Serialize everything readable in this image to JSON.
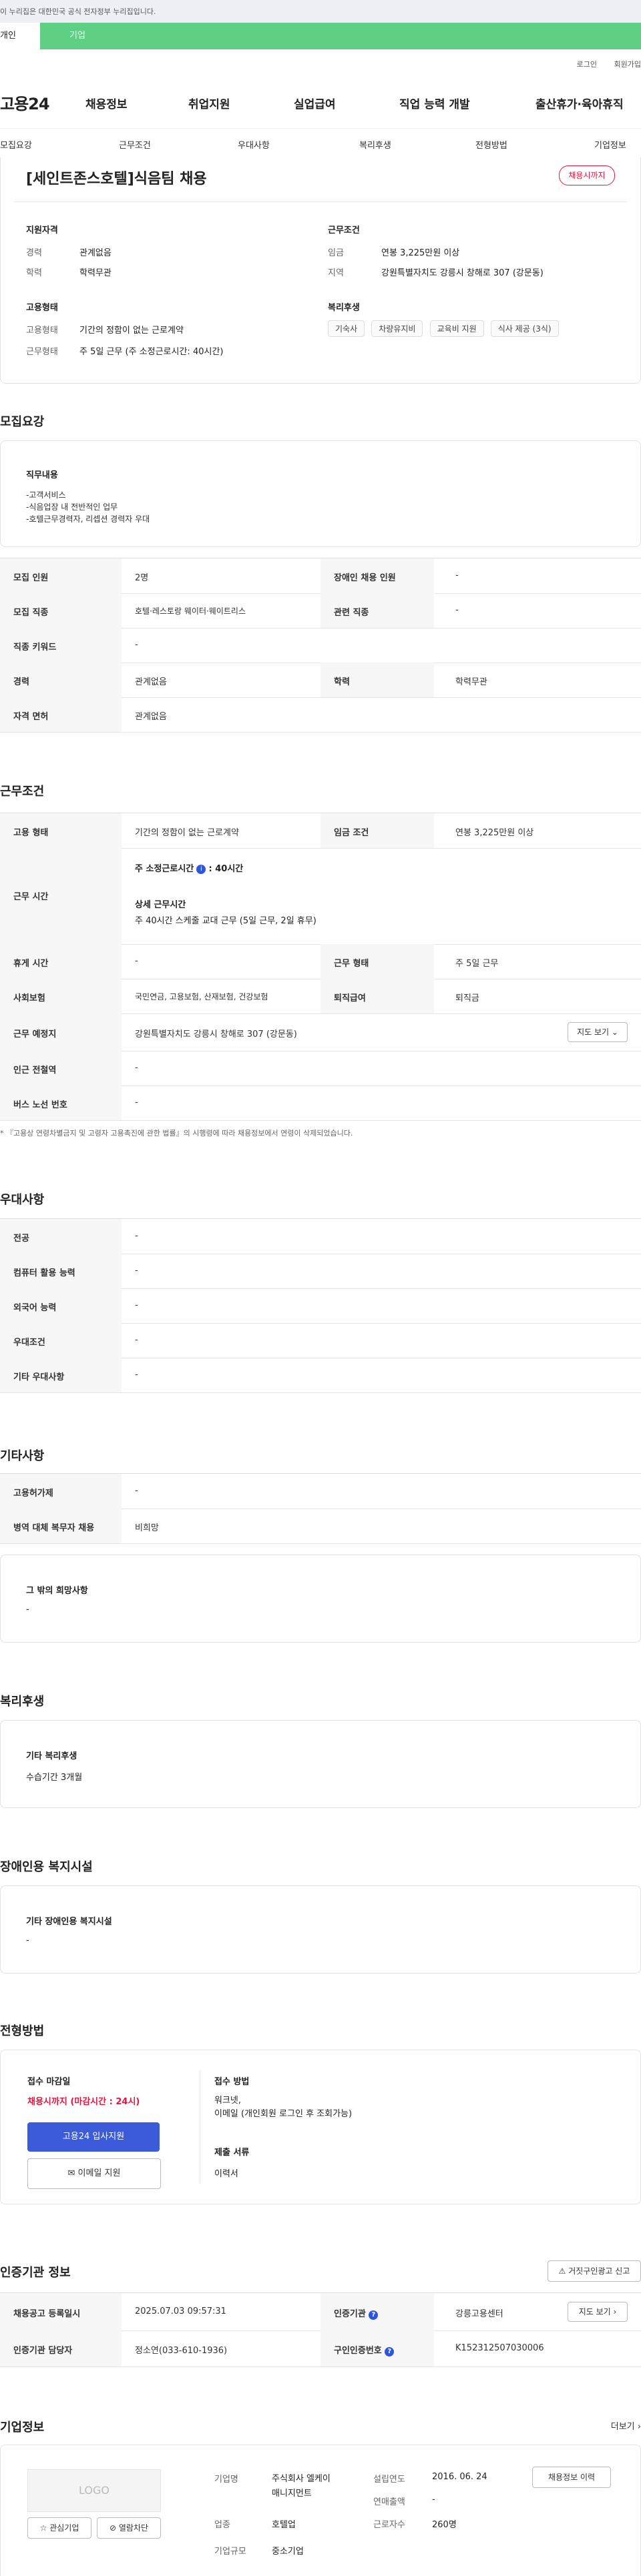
{
  "notice": {
    "text": "이 누리집은 대한민국 공식 전자정부 누리집입니다."
  },
  "topbar": {
    "tab_personal": "개인",
    "tab_company": "기업"
  },
  "util": {
    "login": "로그인",
    "join": "회원가입"
  },
  "gnb": {
    "logo": "고용24",
    "menus": [
      "채용정보",
      "취업지원",
      "실업급여",
      "직업 능력 개발",
      "출산휴가·육아휴직"
    ]
  },
  "subnav": [
    "모집요강",
    "근무조건",
    "우대사항",
    "복리후생",
    "전형방법",
    "기업정보"
  ],
  "summary": {
    "title": "[세인트존스호텔]식음팀 채용",
    "status_badge": "채용시까지",
    "qual_title": "지원자격",
    "career_label": "경력",
    "career_value": "관계없음",
    "edu_label": "학력",
    "edu_value": "학력무관",
    "work_title": "근무조건",
    "wage_label": "임금",
    "wage_value": "연봉 3,225만원 이상",
    "region_label": "지역",
    "region_value": "강원특별자치도 강릉시 창해로 307 (강문동)",
    "emp_title": "고용형태",
    "emp_type_label": "고용형태",
    "emp_type_value": "기간의 정함이 없는 근로계약",
    "work_type_label": "근무형태",
    "work_type_value": "주 5일 근무 (주 소정근로시간: 40시간)",
    "welfare_title": "복리후생",
    "welfare_chips": [
      "기숙사",
      "차량유지비",
      "교육비 지원",
      "식사 제공 (3식)"
    ]
  },
  "recruit": {
    "section_title": "모집요강",
    "duty_title": "직무내용",
    "duty_lines": [
      "-고객서비스",
      "-식음업장 내 전반적인 업무",
      "-호텔근무경력자, 리셉션 경력자 우대"
    ],
    "rows": {
      "headcount_k": "모집 인원",
      "headcount_v": "2명",
      "disabled_k": "장애인 채용 인원",
      "disabled_v": "-",
      "job_k": "모집 직종",
      "job_v": "호텔·레스토랑 웨이터·웨이트리스",
      "related_k": "관련 직종",
      "related_v": "-",
      "keyword_k": "직종 키워드",
      "keyword_v": "-",
      "career_k": "경력",
      "career_v": "관계없음",
      "edu_k": "학력",
      "edu_v": "학력무관",
      "license_k": "자격 면허",
      "license_v": "관계없음"
    }
  },
  "conditions": {
    "section_title": "근무조건",
    "emp_k": "고용 형태",
    "emp_v": "기간의 정함이 없는 근로계약",
    "wage_k": "임금 조건",
    "wage_v": "연봉 3,225만원 이상",
    "hours_k": "근무 시간",
    "hours_weekly_label": "주 소정근로시간",
    "hours_weekly_value": ": 40시간",
    "hours_detail_label": "상세 근무시간",
    "hours_detail_value": "주 40시간 스케줄 교대 근무 (5일 근무, 2일 휴무)",
    "rest_k": "휴게 시간",
    "rest_v": "-",
    "form_k": "근무 형태",
    "form_v": "주 5일 근무",
    "insurance_k": "사회보험",
    "insurance_v": "국민연금, 고용보험, 산재보험, 건강보험",
    "retire_k": "퇴직급여",
    "retire_v": "퇴직금",
    "place_k": "근무 예정지",
    "place_v": "강원특별자치도 강릉시 창해로 307 (강문동)",
    "map_btn": "지도 보기",
    "subway_k": "인근 전철역",
    "subway_v": "-",
    "bus_k": "버스 노선 번호",
    "bus_v": "-",
    "footnote": "* 『고용상 연령차별금지 및 고령자 고용촉진에 관한 법률』의 시행령에 따라 채용정보에서 연령이 삭제되었습니다."
  },
  "preference": {
    "section_title": "우대사항",
    "rows": [
      {
        "k": "전공",
        "v": "-"
      },
      {
        "k": "컴퓨터 활용 능력",
        "v": "-"
      },
      {
        "k": "외국어 능력",
        "v": "-"
      },
      {
        "k": "우대조건",
        "v": "-"
      },
      {
        "k": "기타 우대사항",
        "v": "-"
      }
    ]
  },
  "other": {
    "section_title": "기타사항",
    "rows": [
      {
        "k": "고용허가제",
        "v": "-"
      },
      {
        "k": "병역 대체 복무자 채용",
        "v": "비희망"
      }
    ],
    "etc_title": "그 밖의 희망사항",
    "etc_value": "-"
  },
  "benefits": {
    "section_title": "복리후생",
    "card_title": "기타 복리후생",
    "card_value": "수습기간 3개월"
  },
  "facility": {
    "section_title": "장애인용 복지시설",
    "card_title": "기타 장애인용 복지시설",
    "card_value": "-"
  },
  "method": {
    "section_title": "전형방법",
    "deadline_title": "접수 마감일",
    "deadline_value": "채용시까지 (마감시간 : 24시)",
    "apply_btn": "고용24 입사지원",
    "email_btn": "이메일 지원",
    "how_title": "접수 방법",
    "how_lines": [
      "워크넷,",
      "이메일 (개인회원 로그인 후 조회가능)"
    ],
    "docs_title": "제출 서류",
    "docs_value": "이력서"
  },
  "agency": {
    "section_title": "인증기관 정보",
    "report_btn": "거짓구인광고 신고",
    "reg_k": "채용공고 등록일시",
    "reg_v": "2025.07.03 09:57:31",
    "cert_k": "인증기관",
    "cert_v": "강릉고용센터",
    "map_btn": "지도 보기",
    "mgr_k": "인증기관 담당자",
    "mgr_v": "정소연(033-610-1936)",
    "auth_k": "구인인증번호",
    "auth_v": "K152312507030006"
  },
  "company": {
    "section_title": "기업정보",
    "more": "더보기",
    "logo_text": "LOGO",
    "fav_btn": "관심기업",
    "block_btn": "열람차단",
    "name_k": "기업명",
    "name_v1": "주식회사 엘케이",
    "name_v2": "매니지먼트",
    "industry_k": "업종",
    "industry_v": "호텔업",
    "size_k": "기업규모",
    "size_v": "중소기업",
    "founded_k": "설립연도",
    "founded_v": "2016. 06. 24",
    "sales_k": "연매출액",
    "sales_v": "-",
    "staff_k": "근로자수",
    "staff_v": "260명",
    "history_btn": "채용정보 이력"
  }
}
